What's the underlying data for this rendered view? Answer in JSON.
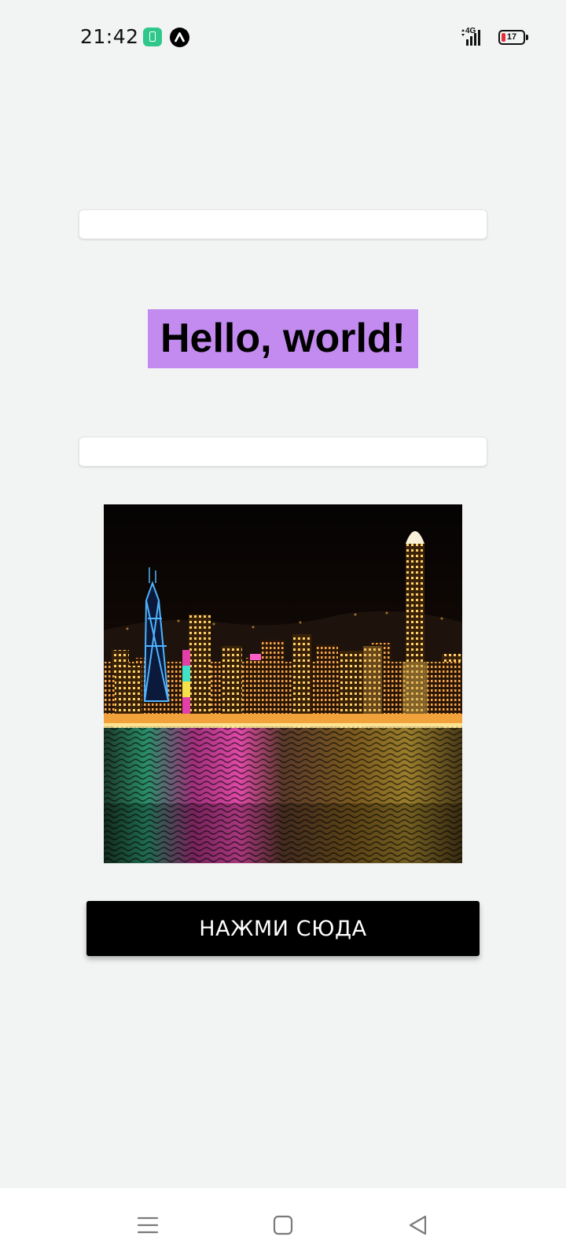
{
  "status_bar": {
    "time": "21:42",
    "network": "4G",
    "battery_level": "17",
    "battery_color": "#e2303a",
    "notification_icons": [
      "battery-saver-icon",
      "app-notification-icon"
    ]
  },
  "main": {
    "top_input": {
      "value": "",
      "placeholder": ""
    },
    "greeting": "Hello, world!",
    "greeting_background": "#c38bef",
    "bottom_input": {
      "value": "",
      "placeholder": ""
    },
    "image": {
      "subject": "night-city-skyline-icon"
    },
    "button_label": "НАЖМИ СЮДА"
  },
  "navigation_bar": {
    "buttons": [
      "menu-icon",
      "home-icon",
      "back-icon"
    ]
  },
  "colors": {
    "background": "#f2f3f3",
    "button_background": "#000000",
    "button_text": "#ffffff"
  }
}
